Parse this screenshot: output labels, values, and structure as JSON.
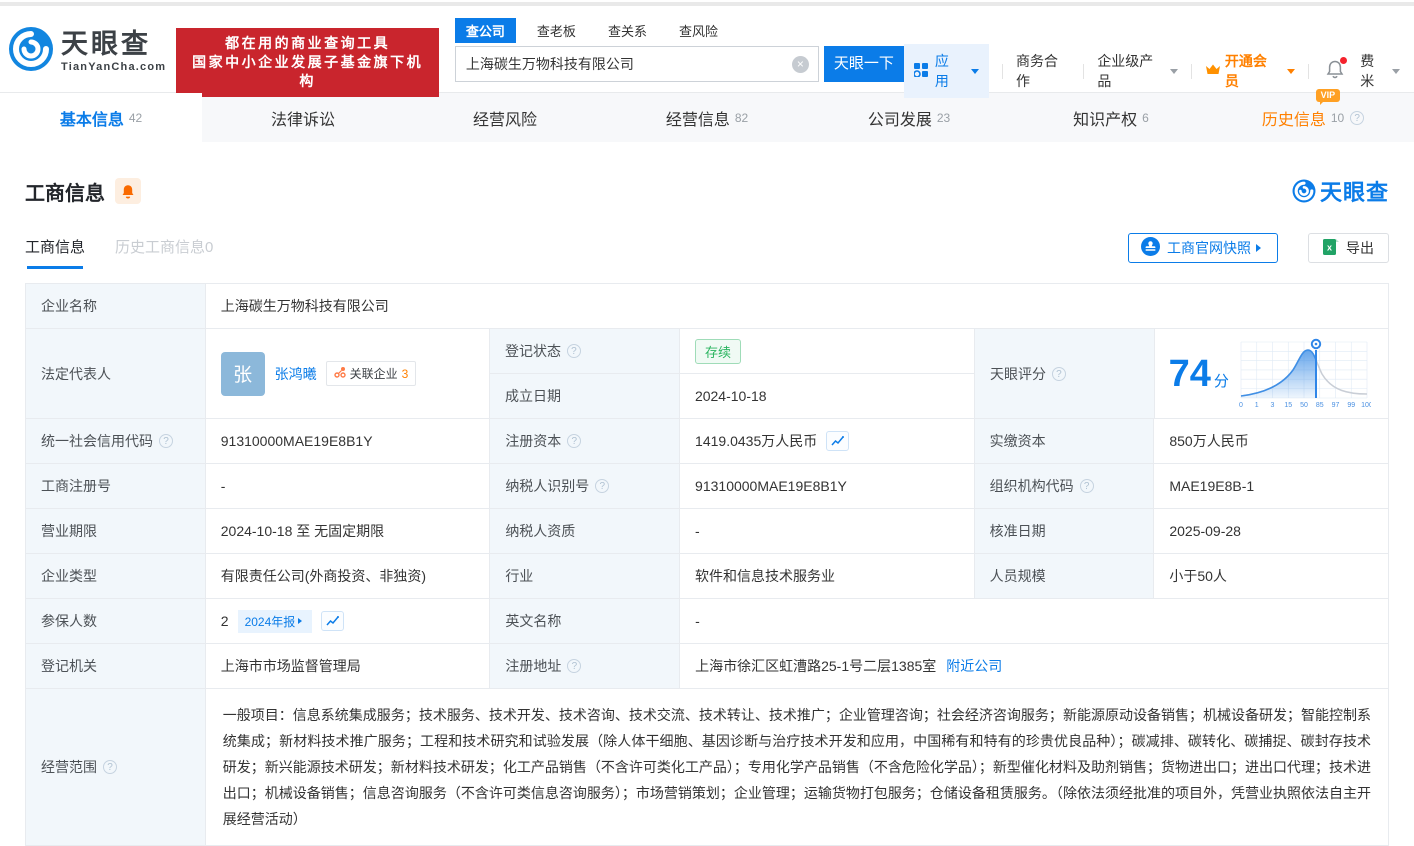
{
  "icons": {
    "qmark": "?",
    "clear": "×",
    "vip_badge": "VIP"
  },
  "header": {
    "logo": {
      "brand": "天眼查",
      "domain": "TianYanCha.com"
    },
    "slogan_line1": "都在用的商业查询工具",
    "slogan_line2": "国家中小企业发展子基金旗下机构",
    "search": {
      "tabs": [
        {
          "label": "查公司"
        },
        {
          "label": "查老板"
        },
        {
          "label": "查关系"
        },
        {
          "label": "查风险"
        }
      ],
      "value": "上海碳生万物科技有限公司",
      "button": "天眼一下"
    },
    "nav": {
      "apps": "应用",
      "cooperation": "商务合作",
      "enterprise": "企业级产品",
      "vip": "开通会员",
      "username": "费米"
    }
  },
  "main_tabs": [
    {
      "label": "基本信息",
      "count": "42"
    },
    {
      "label": "法律诉讼",
      "count": ""
    },
    {
      "label": "经营风险",
      "count": ""
    },
    {
      "label": "经营信息",
      "count": "82"
    },
    {
      "label": "公司发展",
      "count": "23"
    },
    {
      "label": "知识产权",
      "count": "6"
    },
    {
      "label": "历史信息",
      "count": "10"
    }
  ],
  "section": {
    "title": "工商信息",
    "watermark_brand": "天眼查",
    "subtab_active": "工商信息",
    "subtab_history": "历史工商信息0",
    "snapshot": "工商官网快照",
    "export": "导出"
  },
  "table": {
    "company_name": {
      "label": "企业名称",
      "value": "上海碳生万物科技有限公司"
    },
    "legal_rep": {
      "label": "法定代表人",
      "avatar": "张",
      "name": "张鸿曦",
      "related_label": "关联企业",
      "related_count": "3"
    },
    "reg_status": {
      "label": "登记状态",
      "value": "存续"
    },
    "establish_date": {
      "label": "成立日期",
      "value": "2024-10-18"
    },
    "score": {
      "label": "天眼评分",
      "value": "74",
      "unit": "分"
    },
    "credit_code": {
      "label": "统一社会信用代码",
      "value": "91310000MAE19E8B1Y"
    },
    "reg_capital": {
      "label": "注册资本",
      "value": "1419.0435万人民币"
    },
    "paid_capital": {
      "label": "实缴资本",
      "value": "850万人民币"
    },
    "reg_number": {
      "label": "工商注册号",
      "value": "-"
    },
    "taxpayer_id": {
      "label": "纳税人识别号",
      "value": "91310000MAE19E8B1Y"
    },
    "org_code": {
      "label": "组织机构代码",
      "value": "MAE19E8B-1"
    },
    "business_term": {
      "label": "营业期限",
      "value": "2024-10-18 至 无固定期限"
    },
    "taxpayer_quality": {
      "label": "纳税人资质",
      "value": "-"
    },
    "approval_date": {
      "label": "核准日期",
      "value": "2025-09-28"
    },
    "company_type": {
      "label": "企业类型",
      "value": "有限责任公司(外商投资、非独资)"
    },
    "industry": {
      "label": "行业",
      "value": "软件和信息技术服务业"
    },
    "staff_size": {
      "label": "人员规模",
      "value": "小于50人"
    },
    "insured_count": {
      "label": "参保人数",
      "value": "2",
      "report_badge": "2024年报"
    },
    "english_name": {
      "label": "英文名称",
      "value": "-"
    },
    "reg_authority": {
      "label": "登记机关",
      "value": "上海市市场监督管理局"
    },
    "reg_address": {
      "label": "注册地址",
      "value": "上海市徐汇区虹漕路25-1号二层1385室",
      "nearby_link": "附近公司"
    },
    "business_scope": {
      "label": "经营范围",
      "value": "一般项目：信息系统集成服务；技术服务、技术开发、技术咨询、技术交流、技术转让、技术推广；企业管理咨询；社会经济咨询服务；新能源原动设备销售；机械设备研发；智能控制系统集成；新材料技术推广服务；工程和技术研究和试验发展（除人体干细胞、基因诊断与治疗技术开发和应用，中国稀有和特有的珍贵优良品种）；碳减排、碳转化、碳捕捉、碳封存技术研发；新兴能源技术研发；新材料技术研发；化工产品销售（不含许可类化工产品）；专用化学产品销售（不含危险化学品）；新型催化材料及助剂销售；货物进出口；进出口代理；技术进出口；机械设备销售；信息咨询服务（不含许可类信息咨询服务）；市场营销策划；企业管理；运输货物打包服务；仓储设备租赁服务。（除依法须经批准的项目外，凭营业执照依法自主开展经营活动）"
    }
  },
  "chart_data": {
    "type": "area",
    "title": "天眼评分分布曲线",
    "x_ticks": [
      "0",
      "1",
      "3",
      "15",
      "50",
      "85",
      "97",
      "99",
      "100"
    ],
    "score_marker": 74,
    "accent_color": "#3f8fe6",
    "inactive_color": "#c9ced6"
  },
  "colors": {
    "primary_blue": "#0b7ce8",
    "banner_red": "#c9252d",
    "vip_orange": "#ff8000",
    "status_green": "#2ab45f",
    "label_cell_bg": "#f2f7fb"
  }
}
